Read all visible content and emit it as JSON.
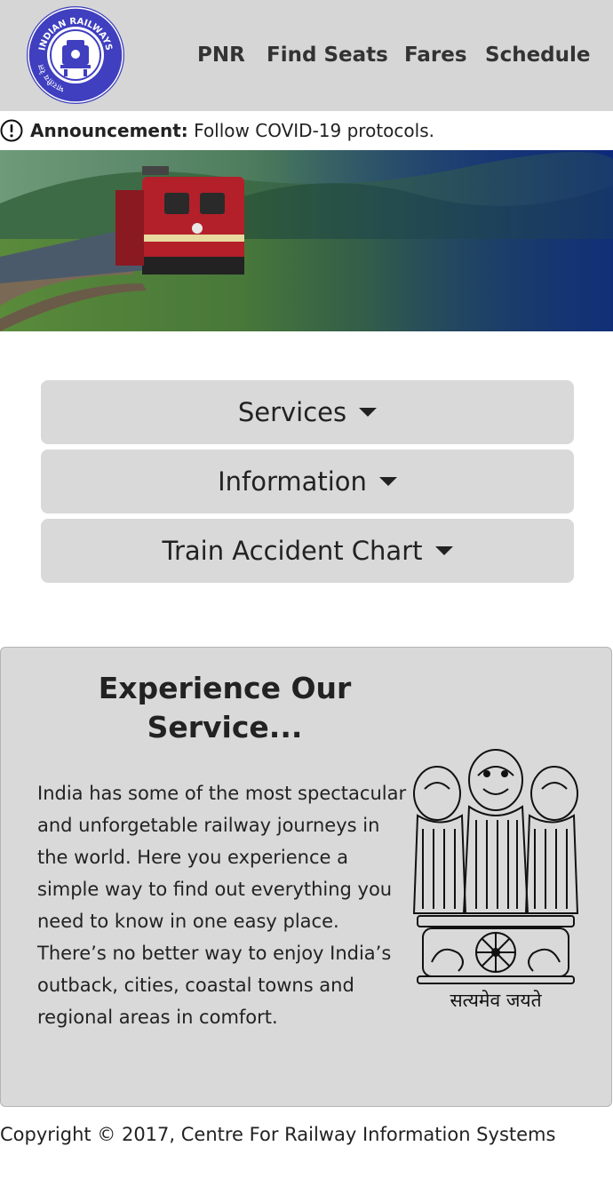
{
  "header": {
    "logo_icon": "indian-railways-logo",
    "logo_text_top": "INDIAN RAILWAYS",
    "logo_text_left": "भारतीय रेल",
    "nav": [
      {
        "label": "PNR"
      },
      {
        "label": "Find Seats"
      },
      {
        "label": "Fares"
      },
      {
        "label": "Schedule"
      }
    ]
  },
  "announcement": {
    "icon": "exclamation-circle-icon",
    "label": "Announcement:",
    "text": " Follow COVID-19 protocols."
  },
  "hero": {
    "image": "train-landscape"
  },
  "dropdowns": [
    {
      "label": "Services"
    },
    {
      "label": "Information"
    },
    {
      "label": "Train Accident Chart"
    }
  ],
  "panel": {
    "title": "Experience Our Service...",
    "body": "India has some of the most spectacular and unforgetable railway journeys in the world. Here you experience a simple way to find out everything you need to know in one easy place. There’s no better way to enjoy India’s outback, cities, coastal towns and regional areas in comfort.",
    "emblem_motto": "सत्यमेव जयते"
  },
  "footer": {
    "copyright": "Copyright © 2017, Centre For Railway Information Systems"
  },
  "colors": {
    "header_bg": "#d6d6d6",
    "logo_blue": "#3f3fbf",
    "panel_bg": "#d9d9d9",
    "button_bg": "#d9d9d9",
    "hero_blue": "#0d2a7a"
  }
}
